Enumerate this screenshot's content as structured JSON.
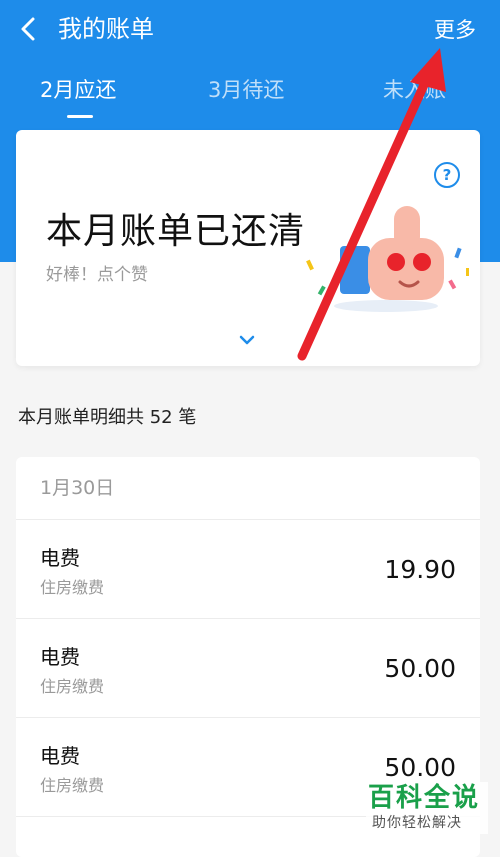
{
  "header": {
    "title": "我的账单",
    "more_label": "更多",
    "tabs": [
      {
        "label": "2月应还",
        "active": true
      },
      {
        "label": "3月待还",
        "active": false
      },
      {
        "label": "未入账",
        "active": false
      }
    ],
    "background_color": "#1e8cea"
  },
  "status_card": {
    "title": "本月账单已还清",
    "subtitle": "好棒！点个赞",
    "help_icon": "question-circle-icon",
    "illustration_icon": "thumbs-up-heart-eyes-icon",
    "expand_icon": "chevron-down-icon"
  },
  "summary": {
    "text": "本月账单明细共 52 笔"
  },
  "bills": {
    "date": "1月30日",
    "items": [
      {
        "name": "电费",
        "category": "住房缴费",
        "amount": "19.90"
      },
      {
        "name": "电费",
        "category": "住房缴费",
        "amount": "50.00"
      },
      {
        "name": "电费",
        "category": "住房缴费",
        "amount": "50.00"
      }
    ]
  },
  "annotation": {
    "arrow_color": "#e8232b"
  },
  "watermark": {
    "main": "百科全说",
    "sub": "助你轻松解决"
  }
}
